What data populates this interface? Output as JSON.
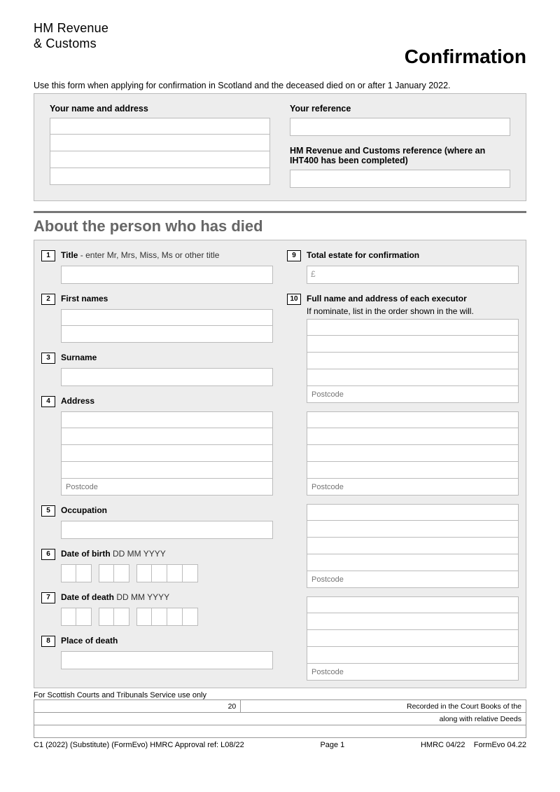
{
  "header": {
    "logo_line1": "HM Revenue",
    "logo_line2": "& Customs",
    "title": "Confirmation",
    "intro": "Use this form when applying for confirmation in Scotland and the deceased died on or after 1 January 2022."
  },
  "top": {
    "name_address_label": "Your name and address",
    "reference_label": "Your reference",
    "hmrc_ref_label": "HM Revenue and Customs reference (where an IHT400 has been completed)"
  },
  "section_title": "About the person who has died",
  "q": {
    "n1": "1",
    "l1": "Title",
    "h1": " - enter Mr, Mrs, Miss, Ms or other title",
    "n2": "2",
    "l2": "First names",
    "n3": "3",
    "l3": "Surname",
    "n4": "4",
    "l4": "Address",
    "postcode": "Postcode",
    "n5": "5",
    "l5": "Occupation",
    "n6": "6",
    "l6": "Date of birth",
    "datehint": "  DD MM YYYY",
    "n7": "7",
    "l7": "Date of death",
    "n8": "8",
    "l8": "Place of death",
    "n9": "9",
    "l9": "Total estate for confirmation",
    "n10": "10",
    "l10": "Full name and address of each executor",
    "h10": "If nominate, list in the order shown in the will."
  },
  "courts": {
    "label": "For Scottish Courts and Tribunals Service use only",
    "c20": "20",
    "recorded": "Recorded in the Court Books of the",
    "deeds": "along with relative Deeds"
  },
  "footer": {
    "left": "C1 (2022)  (Substitute) (FormEvo) HMRC Approval ref: L08/22",
    "page": "Page 1",
    "hmrc": "HMRC 04/22",
    "formevo": "FormEvo 04.22"
  }
}
